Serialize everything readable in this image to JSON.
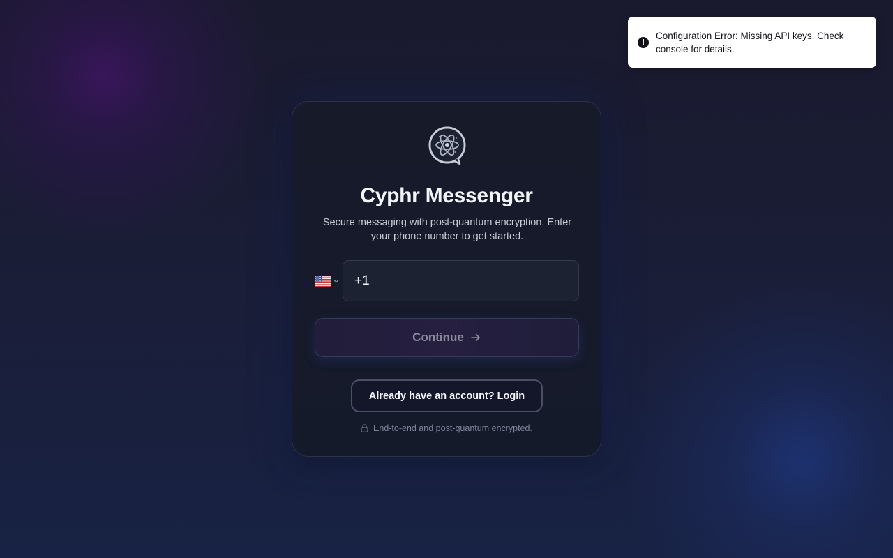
{
  "toast": {
    "icon": "alert-circle-icon",
    "message": "Configuration Error: Missing API keys. Check console for details."
  },
  "card": {
    "logo_icon": "atom-chat-bubble-icon",
    "title": "Cyphr Messenger",
    "subtitle": "Secure messaging with post-quantum encryption. Enter your phone number to get started.",
    "country": {
      "flag_icon": "us-flag-icon",
      "chevron_icon": "chevron-down-icon"
    },
    "phone": {
      "value": "+1",
      "placeholder": ""
    },
    "continue_label": "Continue",
    "continue_icon": "arrow-right-icon",
    "login_label": "Already have an account? Login",
    "footer_icon": "lock-icon",
    "footer_text": "End-to-end and post-quantum encrypted."
  },
  "colors": {
    "background_top": "#1a1a2e",
    "background_bottom": "#182244",
    "card_background": "#171a29",
    "toast_background": "#ffffff",
    "text_primary": "#f3f4f8",
    "text_muted": "#80849a"
  }
}
